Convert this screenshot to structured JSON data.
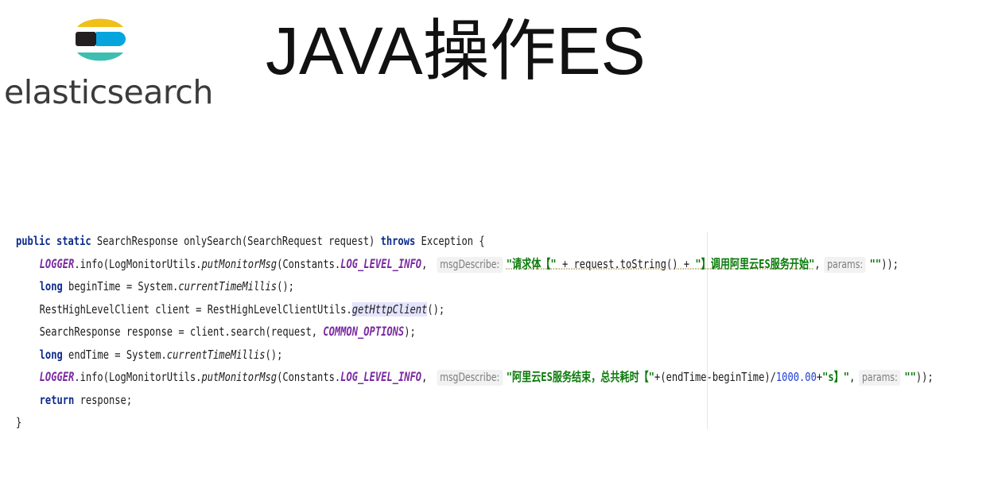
{
  "logo": {
    "wordmark": "elasticsearch",
    "colors": [
      "#F0BF1A",
      "#07A5DE",
      "#3EBEB0",
      "#231F20"
    ]
  },
  "title": "JAVA操作ES",
  "code": {
    "l1": {
      "kw1": "public static",
      "sig": " SearchResponse onlySearch(SearchRequest request) ",
      "kw2": "throws",
      "rest": " Exception {"
    },
    "l2": {
      "logger": "LOGGER",
      "a": ".info(LogMonitorUtils.",
      "method": "putMonitorMsg",
      "b": "(Constants.",
      "level": "LOG_LEVEL_INFO",
      "c": ", ",
      "hint1": "msgDescribe:",
      "s1": "\"请求体【\"",
      "d": " + request.toString() + ",
      "s2": "\"】调用阿里云ES服务开始\"",
      "e": ",",
      "hint2": "params:",
      "s3": "\"\"",
      "f": "));"
    },
    "l3": {
      "kw": "long",
      "a": " beginTime = System.",
      "m": "currentTimeMillis",
      "b": "();"
    },
    "l4": {
      "a": "RestHighLevelClient client = RestHighLevelClientUtils.",
      "m": "getHttpClient",
      "b": "();"
    },
    "l5": {
      "a": "SearchResponse response = client.search(request, ",
      "c": "COMMON_OPTIONS",
      "b": ");"
    },
    "l6": {
      "kw": "long",
      "a": " endTime = System.",
      "m": "currentTimeMillis",
      "b": "();"
    },
    "l7": {
      "logger": "LOGGER",
      "a": ".info(LogMonitorUtils.",
      "method": "putMonitorMsg",
      "b": "(Constants.",
      "level": "LOG_LEVEL_INFO",
      "c": ", ",
      "hint1": "msgDescribe:",
      "s1": "\"阿里云ES服务结束，总共耗时【\"",
      "d": "+(endTime-beginTime)/",
      "n": "1000.00",
      "e": "+",
      "s2": "\"s】\"",
      "f": ",",
      "hint2": "params:",
      "s3": "\"\"",
      "g": "));"
    },
    "l8": {
      "kw": "return",
      "a": " response;"
    },
    "l9": {
      "a": "}"
    }
  }
}
